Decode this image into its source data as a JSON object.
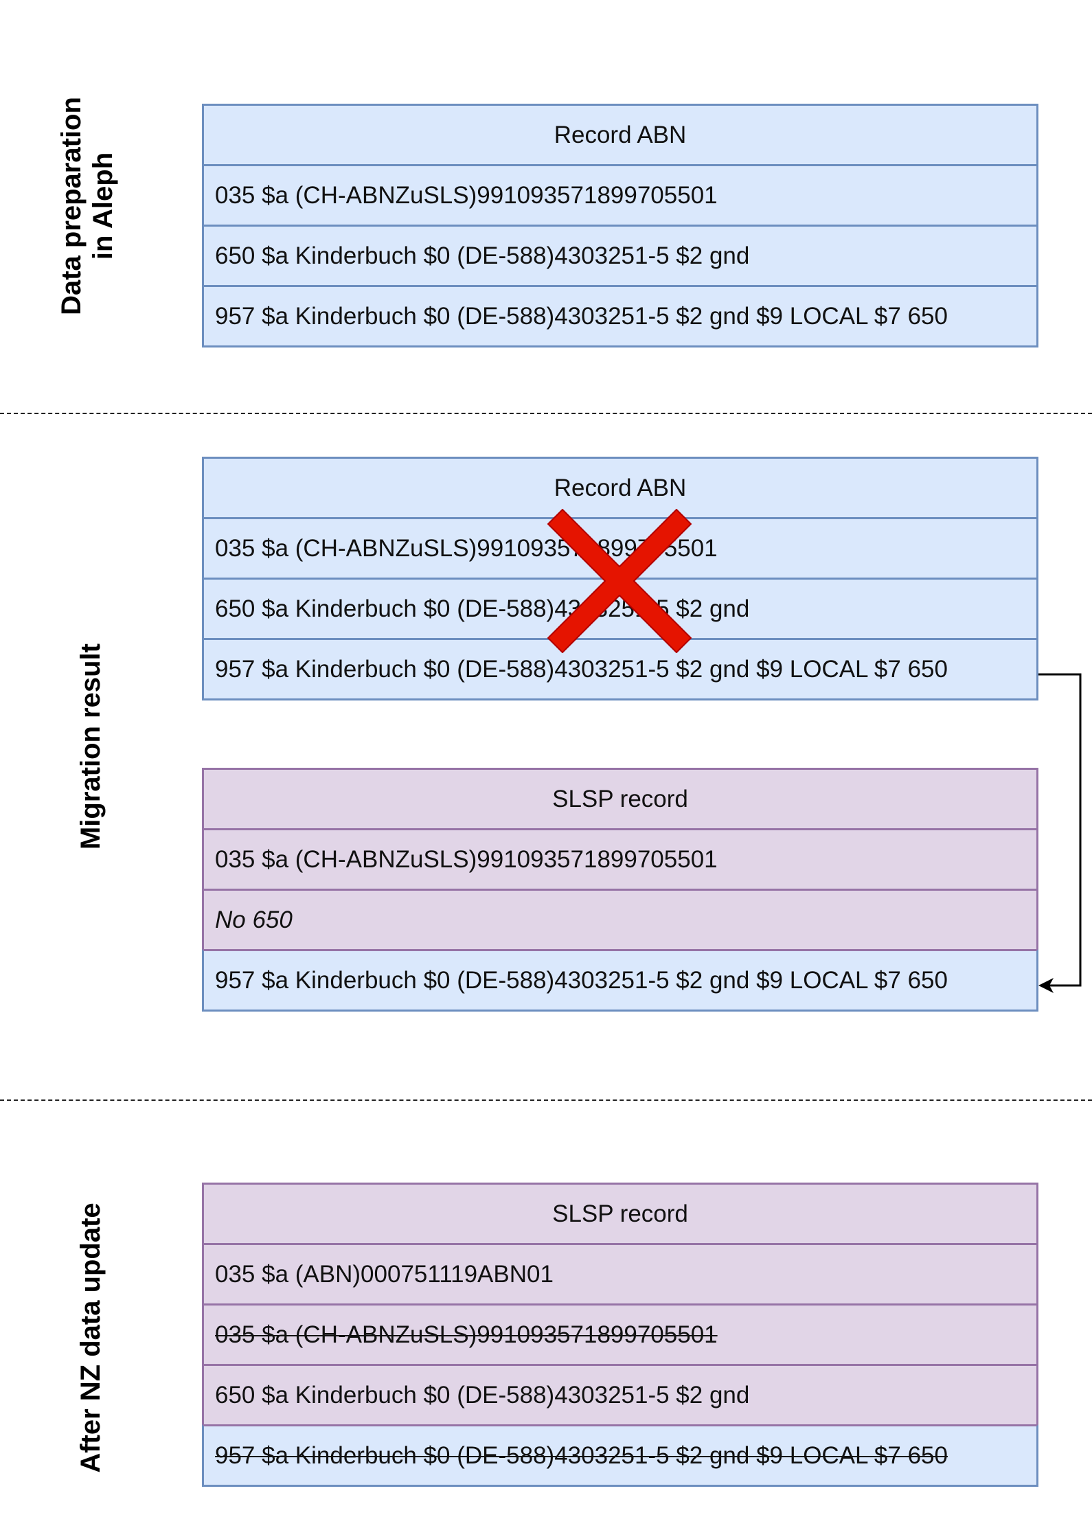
{
  "sections": [
    {
      "label": "Data preparation\nin Aleph"
    },
    {
      "label": "Migration result"
    },
    {
      "label": "After NZ data update"
    }
  ],
  "prep_record": {
    "title": "Record ABN",
    "rows": [
      "035 $a  (CH-ABNZuSLS)991093571899705501",
      "650 $a Kinderbuch $0 (DE-588)4303251-5 $2 gnd",
      "957 $a Kinderbuch $0 (DE-588)4303251-5 $2 gnd $9 LOCAL $7 650"
    ]
  },
  "migration_record": {
    "title": "Record ABN",
    "rows": [
      "035 $a  (CH-ABNZuSLS)991093571899705501",
      "650 $a Kinderbuch $0 (DE-588)4303251-5 $2 gnd",
      "957 $a Kinderbuch $0 (DE-588)4303251-5 $2 gnd $9 LOCAL $7 650"
    ]
  },
  "slsp_record_migration": {
    "title": "SLSP record",
    "rows": [
      "035 $a  (CH-ABNZuSLS)991093571899705501",
      "No 650",
      "957 $a Kinderbuch $0 (DE-588)4303251-5 $2 gnd $9 LOCAL $7 650"
    ]
  },
  "slsp_record_after": {
    "title": "SLSP record",
    "rows": [
      "035 $a  (ABN)000751119ABN01",
      "035 $a  (CH-ABNZuSLS)991093571899705501",
      "650 $a Kinderbuch $0 (DE-588)4303251-5 $2 gnd",
      "957 $a Kinderbuch $0 (DE-588)4303251-5 $2 gnd $9 LOCAL $7 650"
    ]
  },
  "colors": {
    "aleph_fill": "#dae8fc",
    "aleph_stroke": "#6c8ebf",
    "slsp_fill": "#e1d5e7",
    "slsp_stroke": "#9673a6",
    "cross": "#e51400"
  },
  "icons": {
    "deleted_marker": "red-x-cross-icon",
    "copy_connector": "arrow-connector"
  }
}
